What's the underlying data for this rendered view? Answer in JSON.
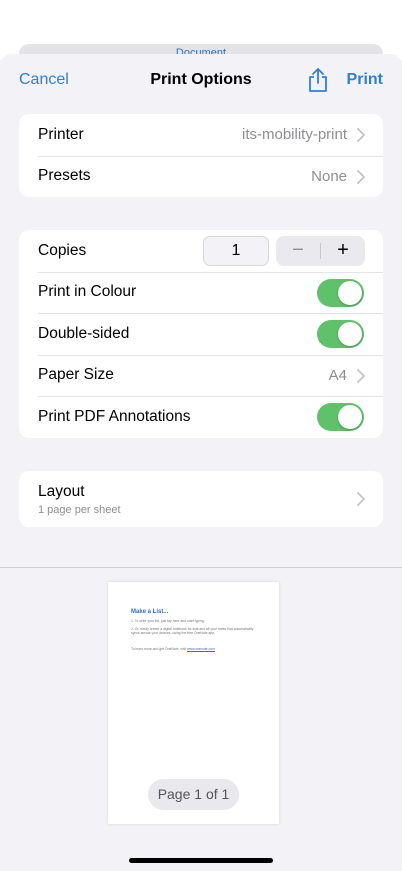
{
  "background_doc": {
    "title": "Document"
  },
  "nav": {
    "cancel": "Cancel",
    "title": "Print Options",
    "print": "Print",
    "share_icon": "share-icon"
  },
  "printer_group": {
    "printer_label": "Printer",
    "printer_value": "its-mobility-print",
    "presets_label": "Presets",
    "presets_value": "None"
  },
  "options_group": {
    "copies_label": "Copies",
    "copies_value": "1",
    "minus": "−",
    "plus": "+",
    "colour_label": "Print in Colour",
    "colour_on": true,
    "duplex_label": "Double-sided",
    "duplex_on": true,
    "paper_label": "Paper Size",
    "paper_value": "A4",
    "annotations_label": "Print PDF Annotations",
    "annotations_on": true
  },
  "layout_group": {
    "title": "Layout",
    "subtitle": "1 page per sheet"
  },
  "preview": {
    "heading": "Make a List...",
    "line1": "1.  To write your list, just tap here and start typing.",
    "line2": "2.  Or, easily create a digital notebook for lists and all your notes that automatically syncs across your devices, using the free OneNote app.",
    "line3_text": "To learn more and get OneNote, visit ",
    "line3_link": "www.onenote.com",
    "page_badge": "Page 1 of 1"
  },
  "colors": {
    "accent": "#2f7fd6",
    "toggle_on": "#5fc16a",
    "background": "#f2f2f7"
  }
}
